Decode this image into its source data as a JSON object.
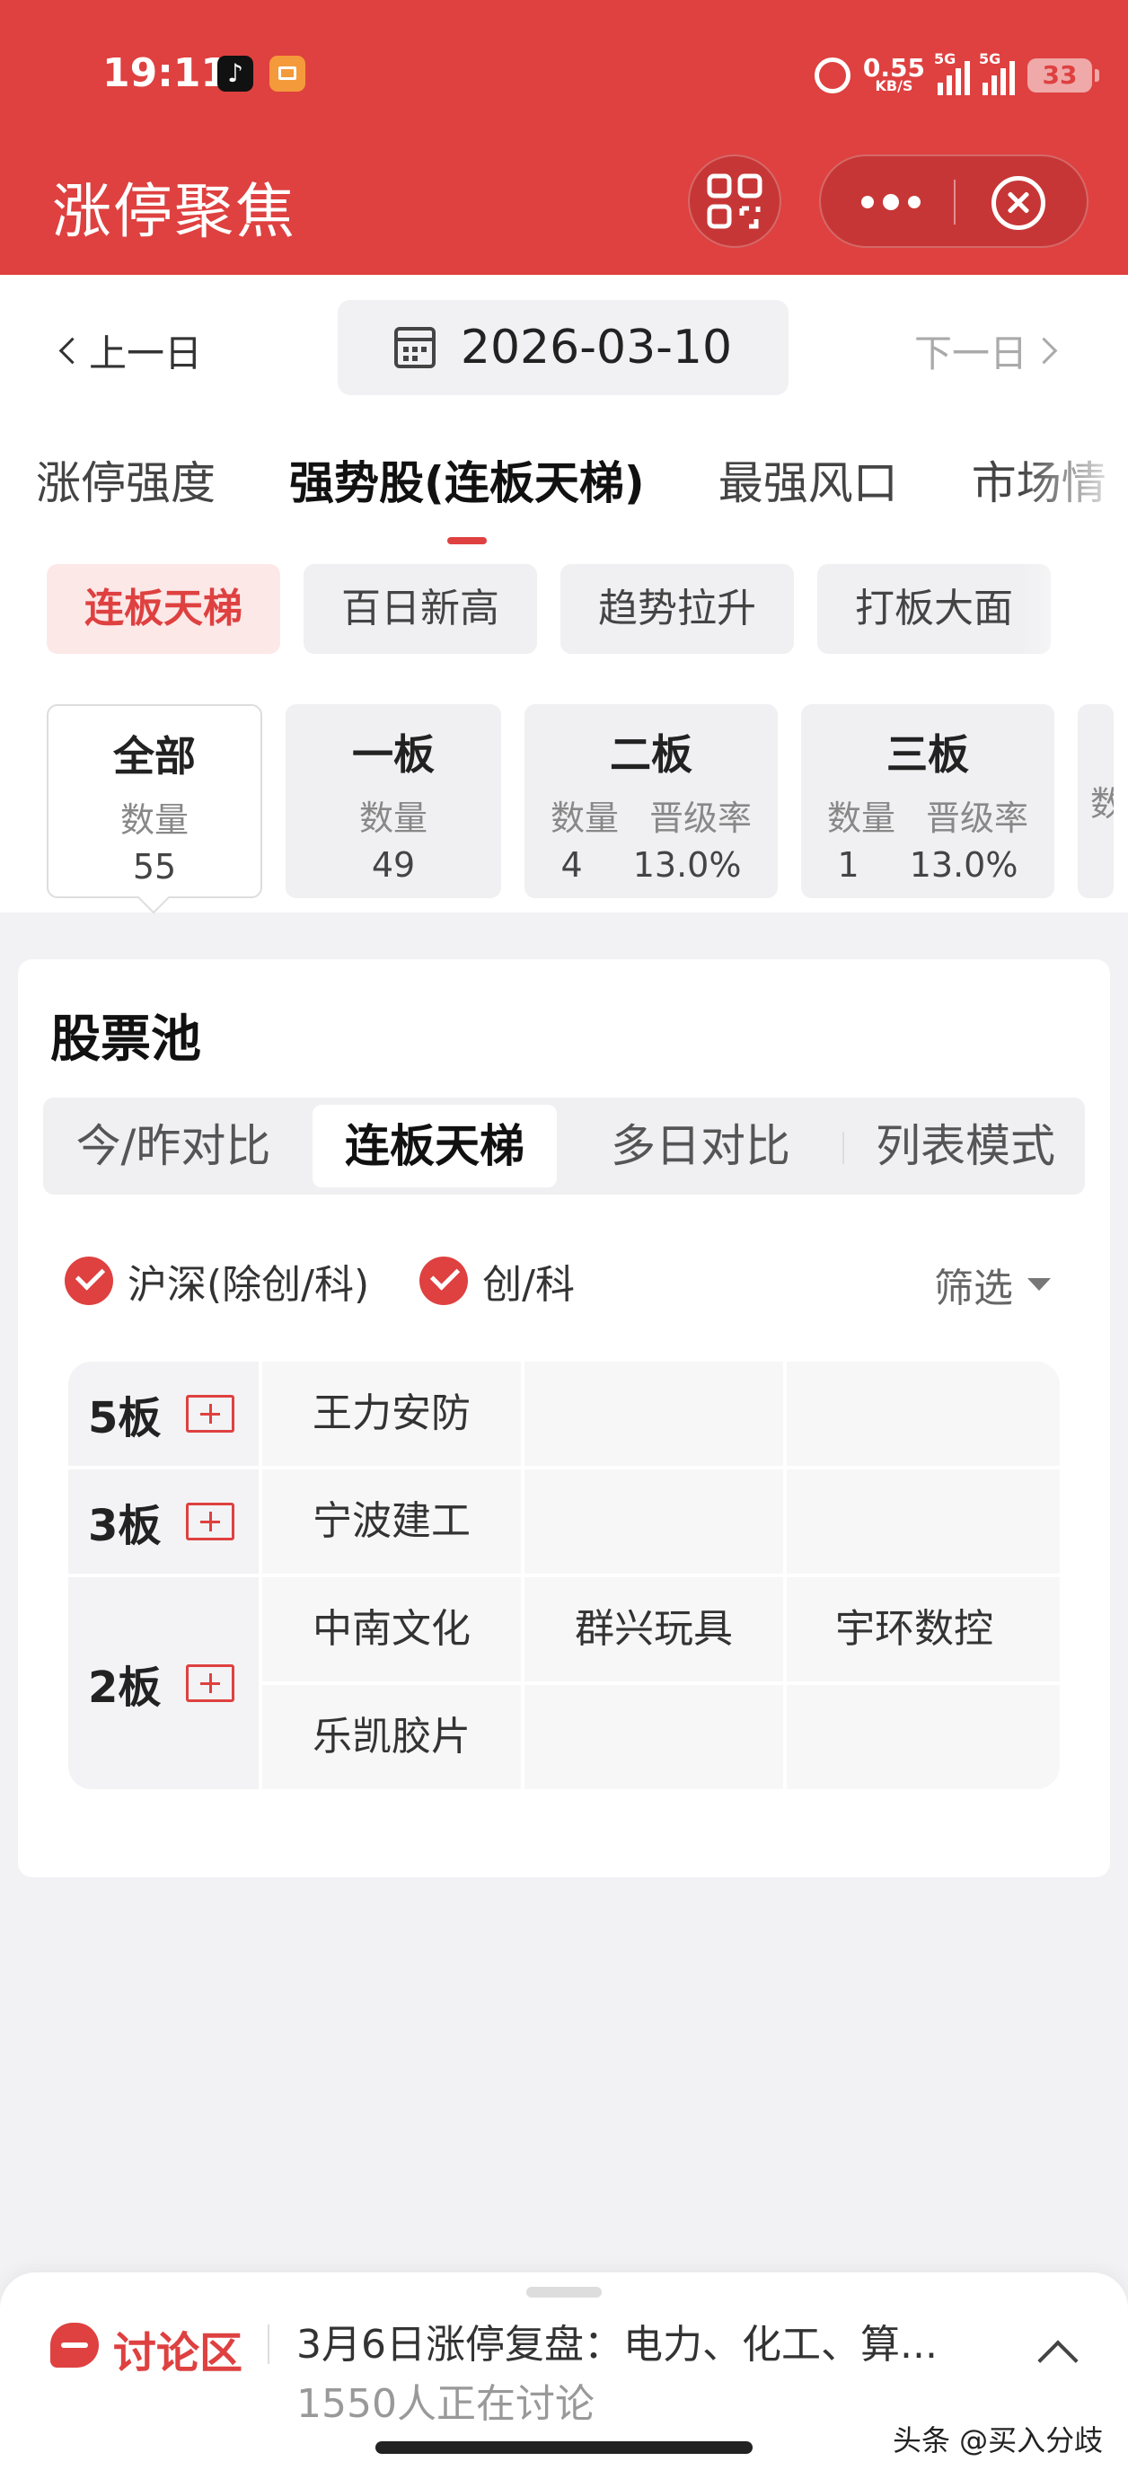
{
  "status_bar": {
    "time": "19:11",
    "app_icons": [
      "tiktok-icon",
      "reader-icon"
    ],
    "net_speed": "0.55",
    "net_unit": "KB/S",
    "signal1_label": "5G",
    "signal2_label": "5G",
    "battery": "33"
  },
  "header": {
    "title": "涨停聚焦",
    "icons": [
      "scan-icon",
      "more-icon",
      "close-icon"
    ]
  },
  "date_nav": {
    "prev": "上一日",
    "date": "2026-03-10",
    "next": "下一日"
  },
  "main_tabs": [
    {
      "label": "涨停强度",
      "active": false
    },
    {
      "label": "强势股(连板天梯)",
      "active": true
    },
    {
      "label": "最强风口",
      "active": false
    },
    {
      "label": "市场情",
      "active": false
    }
  ],
  "sub_chips": [
    {
      "label": "连板天梯",
      "active": true
    },
    {
      "label": "百日新高",
      "active": false
    },
    {
      "label": "趋势拉升",
      "active": false
    },
    {
      "label": "打板大面",
      "active": false
    }
  ],
  "boards": [
    {
      "title": "全部",
      "count_label": "数量",
      "count": "55"
    },
    {
      "title": "一板",
      "count_label": "数量",
      "count": "49"
    },
    {
      "title": "二板",
      "count_label": "数量",
      "count": "4",
      "rate_label": "晋级率",
      "rate": "13.0%"
    },
    {
      "title": "三板",
      "count_label": "数量",
      "count": "1",
      "rate_label": "晋级率",
      "rate": "13.0%"
    },
    {
      "title": "",
      "count_label": "数"
    }
  ],
  "pool": {
    "title": "股票池",
    "views": [
      {
        "label": "今/昨对比",
        "active": false
      },
      {
        "label": "连板天梯",
        "active": true
      },
      {
        "label": "多日对比",
        "active": false
      },
      {
        "label": "列表模式",
        "active": false
      }
    ],
    "filters": [
      {
        "label": "沪深(除创/科)",
        "checked": true
      },
      {
        "label": "创/科",
        "checked": true
      }
    ],
    "screen_label": "筛选",
    "ladder": [
      {
        "level": "5板",
        "rows": [
          [
            "王力安防",
            "",
            ""
          ]
        ]
      },
      {
        "level": "3板",
        "rows": [
          [
            "宁波建工",
            "",
            ""
          ]
        ]
      },
      {
        "level": "2板",
        "rows": [
          [
            "中南文化",
            "群兴玩具",
            "宇环数控"
          ],
          [
            "乐凯胶片",
            "",
            ""
          ]
        ]
      }
    ]
  },
  "discussion": {
    "label": "讨论区",
    "text_line1": "3月6日涨停复盘：电力、化工、算...",
    "text_line2": "1550人正在讨论"
  },
  "watermark": "头条 @买入分歧",
  "colors": {
    "accent": "#de4140",
    "chip_bg": "#f0f0f2",
    "page_bg": "#f2f2f4"
  }
}
